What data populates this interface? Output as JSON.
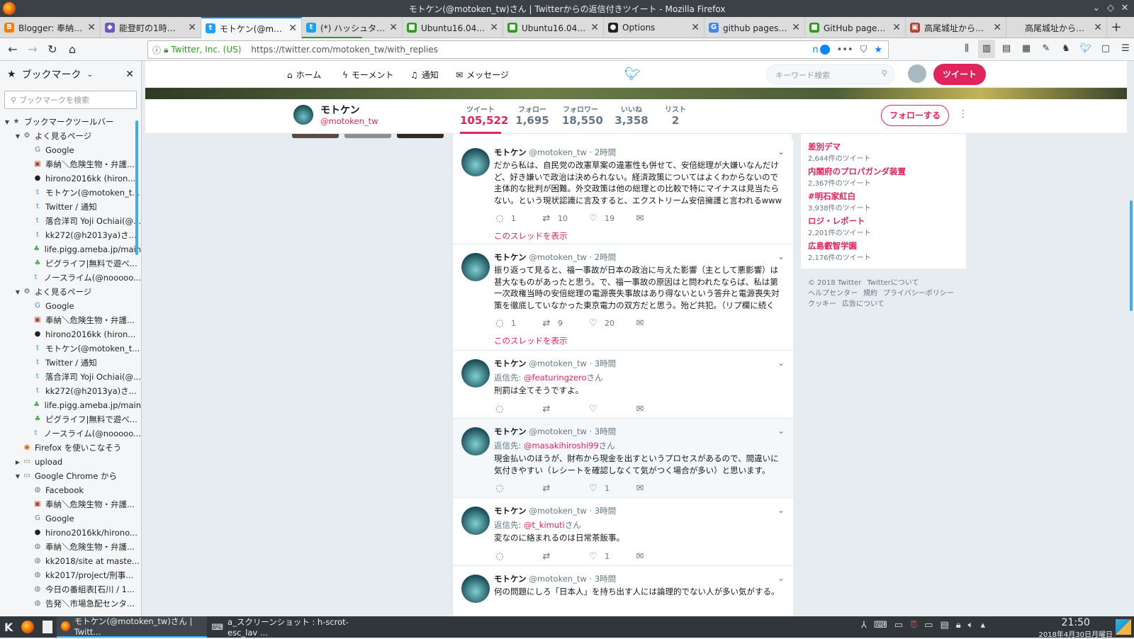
{
  "window": {
    "title": "モトケン(@motoken_tw)さん | Twitterからの返信付きツイート - Mozilla Firefox"
  },
  "tabs": [
    {
      "label": "Blogger: 奉納＼危険",
      "icon_color": "#f57d00",
      "icon": "B",
      "active": false
    },
    {
      "label": "能登町の1時間天気",
      "icon_color": "#6e55c2",
      "icon": "◆",
      "active": false
    },
    {
      "label": "モトケン(@motoken",
      "icon_color": "#1da1f2",
      "icon": "t",
      "active": true
    },
    {
      "label": "(*) ハッシュタグ #も",
      "icon_color": "#1da1f2",
      "icon": "t",
      "active": false,
      "loading": 0.6
    },
    {
      "label": "Ubuntu16.04にap",
      "icon_color": "#2a9d1a",
      "icon": "■",
      "active": false
    },
    {
      "label": "Ubuntu16.04にap",
      "icon_color": "#2a9d1a",
      "icon": "■",
      "active": false
    },
    {
      "label": "Options",
      "icon_color": "#222",
      "icon": "●",
      "active": false
    },
    {
      "label": "github pages タグ",
      "icon_color": "#4285f4",
      "icon": "G",
      "active": false
    },
    {
      "label": "GitHub pagesで更",
      "icon_color": "#2a9d1a",
      "icon": "■",
      "active": false
    },
    {
      "label": "高尾城址から振り返",
      "icon_color": "#b8402f",
      "icon": "▣",
      "active": false
    },
    {
      "label": "高尾城址から振り返る",
      "icon_color": "",
      "icon": "",
      "active": false
    }
  ],
  "nav": {
    "site_identity": "Twitter, Inc. (US)",
    "url": "https://twitter.com/motoken_tw/with_replies",
    "reader_badge": "n"
  },
  "sidebar": {
    "title": "ブックマーク",
    "search_placeholder": "ブックマークを検索",
    "items": [
      {
        "depth": 0,
        "twisty": "▼",
        "icon": "★",
        "icon_color": "#555",
        "label": "ブックマークツールバー"
      },
      {
        "depth": 1,
        "twisty": "▼",
        "icon": "⚙",
        "icon_color": "#555",
        "label": "よく見るページ"
      },
      {
        "depth": 2,
        "twisty": "",
        "icon": "G",
        "icon_color": "#4285f4",
        "label": "Google"
      },
      {
        "depth": 2,
        "twisty": "",
        "icon": "▣",
        "icon_color": "#b8402f",
        "label": "奉納＼危険生物・弁護..."
      },
      {
        "depth": 2,
        "twisty": "",
        "icon": "●",
        "icon_color": "#222",
        "label": "hirono2016kk (hiron..."
      },
      {
        "depth": 2,
        "twisty": "",
        "icon": "t",
        "icon_color": "#1da1f2",
        "label": "モトケン(@motoken_t..."
      },
      {
        "depth": 2,
        "twisty": "",
        "icon": "t",
        "icon_color": "#1da1f2",
        "label": "Twitter / 通知"
      },
      {
        "depth": 2,
        "twisty": "",
        "icon": "t",
        "icon_color": "#1da1f2",
        "label": "落合洋司 Yoji Ochiai(@..."
      },
      {
        "depth": 2,
        "twisty": "",
        "icon": "t",
        "icon_color": "#1da1f2",
        "label": "kk272(@h2013ya)さ..."
      },
      {
        "depth": 2,
        "twisty": "",
        "icon": "♣",
        "icon_color": "#4caf50",
        "label": "life.pigg.ameba.jp/main"
      },
      {
        "depth": 2,
        "twisty": "",
        "icon": "♣",
        "icon_color": "#4caf50",
        "label": "ピグライフ|無料で遊べ..."
      },
      {
        "depth": 2,
        "twisty": "",
        "icon": "t",
        "icon_color": "#1da1f2",
        "label": "ノースライム(@nooooo..."
      },
      {
        "depth": 1,
        "twisty": "▼",
        "icon": "⚙",
        "icon_color": "#555",
        "label": "よく見るページ"
      },
      {
        "depth": 2,
        "twisty": "",
        "icon": "G",
        "icon_color": "#4285f4",
        "label": "Google"
      },
      {
        "depth": 2,
        "twisty": "",
        "icon": "▣",
        "icon_color": "#b8402f",
        "label": "奉納＼危険生物・弁護..."
      },
      {
        "depth": 2,
        "twisty": "",
        "icon": "●",
        "icon_color": "#222",
        "label": "hirono2016kk (hiron..."
      },
      {
        "depth": 2,
        "twisty": "",
        "icon": "t",
        "icon_color": "#1da1f2",
        "label": "モトケン(@motoken_t..."
      },
      {
        "depth": 2,
        "twisty": "",
        "icon": "t",
        "icon_color": "#1da1f2",
        "label": "Twitter / 通知"
      },
      {
        "depth": 2,
        "twisty": "",
        "icon": "t",
        "icon_color": "#1da1f2",
        "label": "落合洋司 Yoji Ochiai(@..."
      },
      {
        "depth": 2,
        "twisty": "",
        "icon": "t",
        "icon_color": "#1da1f2",
        "label": "kk272(@h2013ya)さ..."
      },
      {
        "depth": 2,
        "twisty": "",
        "icon": "♣",
        "icon_color": "#4caf50",
        "label": "life.pigg.ameba.jp/main"
      },
      {
        "depth": 2,
        "twisty": "",
        "icon": "♣",
        "icon_color": "#4caf50",
        "label": "ピグライフ|無料で遊べ..."
      },
      {
        "depth": 2,
        "twisty": "",
        "icon": "t",
        "icon_color": "#1da1f2",
        "label": "ノースライム(@nooooo..."
      },
      {
        "depth": 1,
        "twisty": "",
        "icon": "◉",
        "icon_color": "#e66000",
        "label": "Firefox を使いこなそう"
      },
      {
        "depth": 1,
        "twisty": "▶",
        "icon": "▭",
        "icon_color": "#777",
        "label": "upload"
      },
      {
        "depth": 1,
        "twisty": "▼",
        "icon": "▭",
        "icon_color": "#777",
        "label": "Google Chrome から"
      },
      {
        "depth": 2,
        "twisty": "",
        "icon": "◍",
        "icon_color": "#777",
        "label": "Facebook"
      },
      {
        "depth": 2,
        "twisty": "",
        "icon": "▣",
        "icon_color": "#b8402f",
        "label": "奉納＼危険生物・弁護..."
      },
      {
        "depth": 2,
        "twisty": "",
        "icon": "G",
        "icon_color": "#4285f4",
        "label": "Google"
      },
      {
        "depth": 2,
        "twisty": "",
        "icon": "●",
        "icon_color": "#222",
        "label": "hirono2016kk/hirono..."
      },
      {
        "depth": 2,
        "twisty": "",
        "icon": "◍",
        "icon_color": "#777",
        "label": "奉納＼危険生物・弁護..."
      },
      {
        "depth": 2,
        "twisty": "",
        "icon": "◍",
        "icon_color": "#777",
        "label": "kk2018/site at maste..."
      },
      {
        "depth": 2,
        "twisty": "",
        "icon": "◍",
        "icon_color": "#777",
        "label": "kk2017/project/刑事..."
      },
      {
        "depth": 2,
        "twisty": "",
        "icon": "◍",
        "icon_color": "#777",
        "label": "今日の番組表[石川 / 1..."
      },
      {
        "depth": 2,
        "twisty": "",
        "icon": "◍",
        "icon_color": "#777",
        "label": "告発＼市場急配センタ..."
      }
    ]
  },
  "twitter": {
    "nav": {
      "home": "ホーム",
      "moments": "モーメント",
      "notifications": "通知",
      "messages": "メッセージ"
    },
    "search_placeholder": "キーワード検索",
    "tweet_button": "ツイート",
    "profile": {
      "name": "モトケン",
      "handle": "@motoken_tw"
    },
    "stats": [
      {
        "label": "ツイート",
        "value": "105,522",
        "active": true
      },
      {
        "label": "フォロー",
        "value": "1,695",
        "active": false
      },
      {
        "label": "フォロワー",
        "value": "18,550",
        "active": false
      },
      {
        "label": "いいね",
        "value": "3,358",
        "active": false
      },
      {
        "label": "リスト",
        "value": "2",
        "active": false
      }
    ],
    "follow_button": "フォローする",
    "tweets": [
      {
        "name": "モトケン",
        "handle": "@motoken_tw",
        "time": "· 2時間",
        "reply_to": "",
        "reply_suffix": "",
        "text": "だから私は、自民党の改憲草案の違憲性も併せて、安倍総理が大嫌いなんだけど、好き嫌いで政治は決められない。経済政策についてはよくわからないので主体的な批判が困難。外交政策は他の総理との比較で特にマイナスは見当たらない。という現状認識に言及すると、エクストリーム安倍擁護と言われるwww",
        "replies": "1",
        "retweets": "10",
        "likes": "19",
        "thread": "このスレッドを表示"
      },
      {
        "name": "モトケン",
        "handle": "@motoken_tw",
        "time": "· 2時間",
        "reply_to": "",
        "reply_suffix": "",
        "text": "振り返って見ると、福一事故が日本の政治に与えた影響（主として悪影響）は甚大なものがあったと思う。で、福一事故の原因はと問われたならば、私は第一次政権当時の安倍総理の電源喪失事故はあり得ないという答弁と電源喪失対策を徹底していなかった東京電力の双方だと思う。殆ど共犯。（リプ欄に続く",
        "replies": "1",
        "retweets": "9",
        "likes": "20",
        "thread": "このスレッドを表示"
      },
      {
        "name": "モトケン",
        "handle": "@motoken_tw",
        "time": "· 3時間",
        "reply_label": "返信先: ",
        "reply_to": "@featuringzero",
        "reply_suffix": "さん",
        "text": "刑罰は全てそうですよ。",
        "replies": "",
        "retweets": "",
        "likes": "",
        "thread": ""
      },
      {
        "name": "モトケン",
        "handle": "@motoken_tw",
        "time": "· 3時間",
        "reply_label": "返信先: ",
        "reply_to": "@masakihiroshi99",
        "reply_suffix": "さん",
        "text": "現金払いのほうが、財布から現金を出すというプロセスがあるので、間違いに気付きやすい（レシートを確認しなくて気がつく場合が多い）と思います。",
        "replies": "",
        "retweets": "",
        "likes": "1",
        "thread": ""
      },
      {
        "name": "モトケン",
        "handle": "@motoken_tw",
        "time": "· 3時間",
        "reply_label": "返信先: ",
        "reply_to": "@t_kimuti",
        "reply_suffix": "さん",
        "text": "変なのに絡まれるのは日常茶飯事。",
        "replies": "",
        "retweets": "",
        "likes": "1",
        "thread": ""
      },
      {
        "name": "モトケン",
        "handle": "@motoken_tw",
        "time": "· 3時間",
        "reply_to": "",
        "reply_suffix": "",
        "text": "何の問題にしろ「日本人」を持ち出す人には論理的でない人が多い気がする。",
        "replies": "",
        "retweets": "",
        "likes": "",
        "thread": ""
      }
    ],
    "trends": [
      {
        "name": "差別デマ",
        "count": "2,644件のツイート"
      },
      {
        "name": "内閣府のプロパガンダ装置",
        "count": "2,367件のツイート"
      },
      {
        "name": "#明石家紅白",
        "count": "3,938件のツイート"
      },
      {
        "name": "ロジ・レポート",
        "count": "2,201件のツイート"
      },
      {
        "name": "広島叡智学園",
        "count": "2,176件のツイート"
      }
    ],
    "footer": {
      "copyright": "© 2018 Twitter",
      "about": "Twitterについて",
      "help": "ヘルプセンター",
      "terms": "規約",
      "privacy": "プライバシーポリシー",
      "cookies": "クッキー",
      "ads": "広告について"
    }
  },
  "taskbar": {
    "windows": [
      {
        "label": "モトケン(@motoken_tw)さん | Twitt...",
        "active": true
      },
      {
        "label": "a_スクリーンショット : h-scrot-esc_lav ...",
        "active": false
      }
    ],
    "clock_time": "21:50",
    "clock_date": "2018年4月30日月曜日"
  }
}
